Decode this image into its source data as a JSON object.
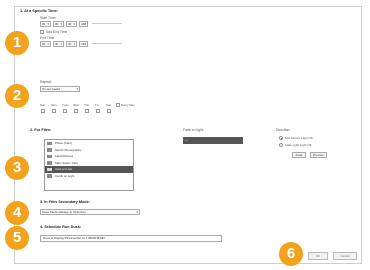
{
  "section1": {
    "heading": "1. At a Specific Time:",
    "start_time_label": "Start Time:",
    "start_fields": [
      "00",
      "00",
      "00"
    ],
    "start_ampm": "AM",
    "add_end_time_label": "Add End Time",
    "end_time_label": "End Time:",
    "end_fields": [
      "00",
      "00",
      "00"
    ],
    "end_ampm": "AM",
    "repeat_label": "Repeat:",
    "repeat_value": "On set weeks",
    "days": [
      "Sun",
      "Mon",
      "Tues",
      "Wed",
      "Thu",
      "Fri",
      "Sat"
    ],
    "every_day_label": "Every Day"
  },
  "section2": {
    "heading": "2. For Files:",
    "files": [
      {
        "label": "Photo (Cam)"
      },
      {
        "label": "Sports Photography"
      },
      {
        "label": "Field Pictures"
      },
      {
        "label": "Main Sweet Jobs"
      },
      {
        "label": "Cars on Lots"
      },
      {
        "label": "Cards on Light"
      }
    ],
    "selected_index": 4,
    "fade_label": "Fade to Light:",
    "fade_value": "---",
    "direction_label": "Direction:",
    "direction_options": [
      "Left Screen Light Off",
      "Fade Light Light Off"
    ],
    "direction_selected": 0,
    "fade_btn": "Fade",
    "preview_btn": "Preview"
  },
  "section3": {
    "heading": "3. In Files Secondary Mode:",
    "value": "Store Mode (always 1) Optimize)"
  },
  "section4": {
    "heading": "4. Schedule Run Dusk:",
    "value": "Drive of Display/Pictures/Jan at 7:06M/PM/MP/"
  },
  "footer": {
    "ok_label": "OK",
    "cancel_label": "Cancel"
  },
  "markers": [
    "1",
    "2",
    "3",
    "4",
    "5",
    "6"
  ],
  "colors": {
    "marker": "#f3a21c",
    "selection": "#555555"
  }
}
